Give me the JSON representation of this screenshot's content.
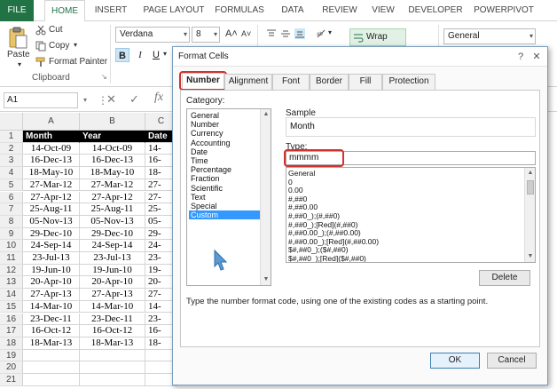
{
  "ribbon": {
    "tabs": [
      {
        "label": "FILE"
      },
      {
        "label": "HOME"
      },
      {
        "label": "INSERT"
      },
      {
        "label": "PAGE LAYOUT"
      },
      {
        "label": "FORMULAS"
      },
      {
        "label": "DATA"
      },
      {
        "label": "REVIEW"
      },
      {
        "label": "VIEW"
      },
      {
        "label": "DEVELOPER"
      },
      {
        "label": "POWERPIVOT"
      }
    ],
    "clipboard": {
      "paste": "Paste",
      "cut": "Cut",
      "copy": "Copy",
      "format_painter": "Format Painter",
      "group_label": "Clipboard"
    },
    "font": {
      "name": "Verdana",
      "size": "8",
      "bold": "B",
      "italic": "I",
      "underline": "U"
    },
    "alignment": {
      "wrap_text": "Wrap Text"
    },
    "number": {
      "format": "General"
    }
  },
  "formula_bar": {
    "name_box": "A1",
    "cancel": "✕",
    "enter": "✓",
    "fx": "fx"
  },
  "sheet": {
    "columns": [
      "A",
      "B",
      "C"
    ],
    "header_row": [
      "Month",
      "Year",
      "Date"
    ],
    "rows": [
      {
        "n": "1"
      },
      {
        "n": "2",
        "a": "14-Oct-09",
        "b": "14-Oct-09",
        "c": "14-"
      },
      {
        "n": "3",
        "a": "16-Dec-13",
        "b": "16-Dec-13",
        "c": "16-"
      },
      {
        "n": "4",
        "a": "18-May-10",
        "b": "18-May-10",
        "c": "18-"
      },
      {
        "n": "5",
        "a": "27-Mar-12",
        "b": "27-Mar-12",
        "c": "27-"
      },
      {
        "n": "6",
        "a": "27-Apr-12",
        "b": "27-Apr-12",
        "c": "27-"
      },
      {
        "n": "7",
        "a": "25-Aug-11",
        "b": "25-Aug-11",
        "c": "25-"
      },
      {
        "n": "8",
        "a": "05-Nov-13",
        "b": "05-Nov-13",
        "c": "05-"
      },
      {
        "n": "9",
        "a": "29-Dec-10",
        "b": "29-Dec-10",
        "c": "29-"
      },
      {
        "n": "10",
        "a": "24-Sep-14",
        "b": "24-Sep-14",
        "c": "24-"
      },
      {
        "n": "11",
        "a": "23-Jul-13",
        "b": "23-Jul-13",
        "c": "23-"
      },
      {
        "n": "12",
        "a": "19-Jun-10",
        "b": "19-Jun-10",
        "c": "19-"
      },
      {
        "n": "13",
        "a": "20-Apr-10",
        "b": "20-Apr-10",
        "c": "20-"
      },
      {
        "n": "14",
        "a": "27-Apr-13",
        "b": "27-Apr-13",
        "c": "27-"
      },
      {
        "n": "15",
        "a": "14-Mar-10",
        "b": "14-Mar-10",
        "c": "14-"
      },
      {
        "n": "16",
        "a": "23-Dec-11",
        "b": "23-Dec-11",
        "c": "23-"
      },
      {
        "n": "17",
        "a": "16-Oct-12",
        "b": "16-Oct-12",
        "c": "16-"
      },
      {
        "n": "18",
        "a": "18-Mar-13",
        "b": "18-Mar-13",
        "c": "18-"
      },
      {
        "n": "19"
      },
      {
        "n": "20"
      },
      {
        "n": "21"
      }
    ]
  },
  "dialog": {
    "title": "Format Cells",
    "help": "?",
    "close": "✕",
    "tabs": [
      "Number",
      "Alignment",
      "Font",
      "Border",
      "Fill",
      "Protection"
    ],
    "category_label": "Category:",
    "categories": [
      "General",
      "Number",
      "Currency",
      "Accounting",
      "Date",
      "Time",
      "Percentage",
      "Fraction",
      "Scientific",
      "Text",
      "Special",
      "Custom"
    ],
    "selected_category": "Custom",
    "sample_label": "Sample",
    "sample_value": "Month",
    "type_label": "Type:",
    "type_value": "mmmm",
    "formats": [
      "General",
      "0",
      "0.00",
      "#,##0",
      "#,##0.00",
      "#,##0_);(#,##0)",
      "#,##0_);[Red](#,##0)",
      "#,##0.00_);(#,##0.00)",
      "#,##0.00_);[Red](#,##0.00)",
      "$#,##0_);($#,##0)",
      "$#,##0_);[Red]($#,##0)"
    ],
    "delete": "Delete",
    "hint": "Type the number format code, using one of the existing codes as a starting point.",
    "ok": "OK",
    "cancel": "Cancel"
  },
  "colors": {
    "excel_green": "#217346",
    "selection_blue": "#3399ff",
    "highlight_red": "#d0322e",
    "header_fill": "#000000"
  }
}
